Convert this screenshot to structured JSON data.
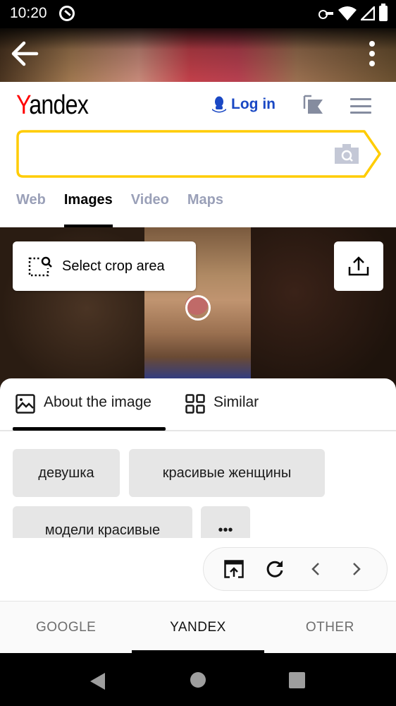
{
  "status_bar": {
    "time": "10:20",
    "icons": [
      "at-sign-icon",
      "vpn-key-icon",
      "wifi-icon",
      "signal-icon",
      "battery-icon"
    ]
  },
  "top_bar": {
    "back_icon": "arrow-left-icon",
    "more_icon": "more-vertical-icon"
  },
  "header": {
    "logo_first": "Y",
    "logo_rest": "andex",
    "login_label": "Log in",
    "collections_icon": "collections-flag-icon",
    "menu_icon": "hamburger-menu-icon"
  },
  "search": {
    "value": "",
    "placeholder": "",
    "camera_icon": "camera-search-icon",
    "border_color": "#ffcc00"
  },
  "service_tabs": [
    {
      "label": "Web",
      "active": false
    },
    {
      "label": "Images",
      "active": true
    },
    {
      "label": "Video",
      "active": false
    },
    {
      "label": "Maps",
      "active": false
    }
  ],
  "viewer": {
    "crop_label": "Select crop area",
    "crop_icon": "crop-search-icon",
    "share_icon": "share-upload-icon"
  },
  "sheet": {
    "tabs": [
      {
        "label": "About the image",
        "icon": "image-icon",
        "active": true
      },
      {
        "label": "Similar",
        "icon": "grid-icon",
        "active": false
      }
    ],
    "tags": [
      "девушка",
      "красивые женщины",
      "модели красивые",
      "•••"
    ]
  },
  "nav_pill": {
    "icons": [
      "open-in-browser-icon",
      "refresh-icon",
      "chevron-left-icon",
      "chevron-right-icon"
    ]
  },
  "engine_tabs": [
    {
      "label": "GOOGLE",
      "active": false
    },
    {
      "label": "YANDEX",
      "active": true
    },
    {
      "label": "OTHER",
      "active": false
    }
  ],
  "colors": {
    "brand_red": "#ff0000",
    "login_blue": "#1a48c4",
    "inactive_tab": "#9aa0b8",
    "search_yellow": "#ffcc00"
  }
}
